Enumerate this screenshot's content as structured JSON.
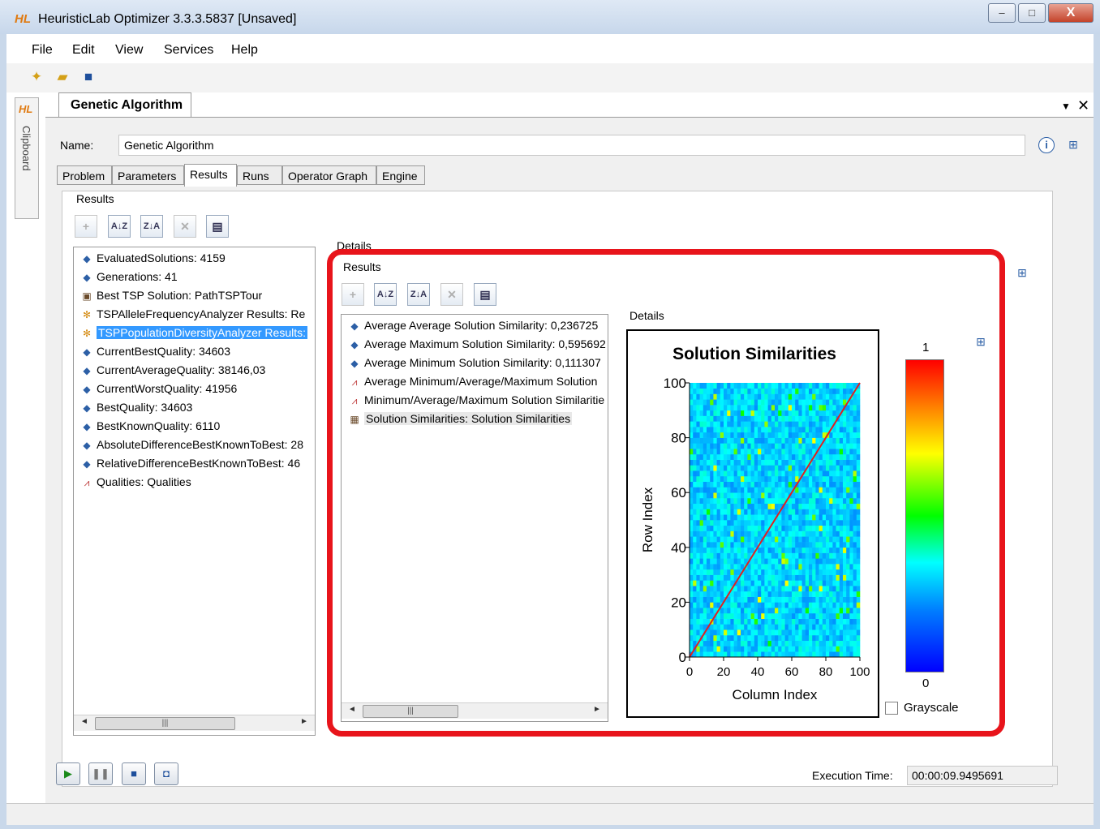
{
  "window": {
    "logo": "HL",
    "title": "HeuristicLab Optimizer 3.3.3.5837 [Unsaved]",
    "controls": {
      "minimize": "–",
      "maximize": "□",
      "close": "X"
    }
  },
  "menu": [
    "File",
    "Edit",
    "View",
    "Services",
    "Help"
  ],
  "sidebar": {
    "logo": "HL",
    "label": "Clipboard"
  },
  "document_tab": {
    "label": "Genetic Algorithm",
    "dropdown_icon": "▼",
    "close_icon": "✕"
  },
  "name_field": {
    "label": "Name:",
    "value": "Genetic Algorithm"
  },
  "tabs": [
    "Problem",
    "Parameters",
    "Results",
    "Runs",
    "Operator Graph",
    "Engine"
  ],
  "active_tab": "Results",
  "results": {
    "group_title": "Results",
    "details_title": "Details",
    "items": [
      {
        "icon": "diamond",
        "text": "EvaluatedSolutions: 4159"
      },
      {
        "icon": "diamond",
        "text": "Generations: 41"
      },
      {
        "icon": "image",
        "text": "Best TSP Solution: PathTSPTour"
      },
      {
        "icon": "gears",
        "text": "TSPAlleleFrequencyAnalyzer Results: Re"
      },
      {
        "icon": "gears",
        "text": "TSPPopulationDiversityAnalyzer Results:"
      },
      {
        "icon": "diamond",
        "text": "CurrentBestQuality: 34603"
      },
      {
        "icon": "diamond",
        "text": "CurrentAverageQuality: 38146,03"
      },
      {
        "icon": "diamond",
        "text": "CurrentWorstQuality: 41956"
      },
      {
        "icon": "diamond",
        "text": "BestQuality: 34603"
      },
      {
        "icon": "diamond",
        "text": "BestKnownQuality: 6110"
      },
      {
        "icon": "diamond",
        "text": "AbsoluteDifferenceBestKnownToBest: 28"
      },
      {
        "icon": "diamond",
        "text": "RelativeDifferenceBestKnownToBest: 46"
      },
      {
        "icon": "chart",
        "text": "Qualities: Qualities"
      }
    ]
  },
  "inner_results": {
    "group_title": "Results",
    "details_title": "Details",
    "items": [
      {
        "icon": "diamond",
        "text": "Average Average Solution Similarity: 0,236725"
      },
      {
        "icon": "diamond",
        "text": "Average Maximum Solution Similarity: 0,595692"
      },
      {
        "icon": "diamond",
        "text": "Average Minimum Solution Similarity: 0,111307"
      },
      {
        "icon": "chart",
        "text": "Average Minimum/Average/Maximum Solution"
      },
      {
        "icon": "chart",
        "text": "Minimum/Average/Maximum Solution Similaritie"
      },
      {
        "icon": "matrix",
        "text": "Solution Similarities: Solution Similarities"
      }
    ]
  },
  "chart_data": {
    "type": "heatmap",
    "title": "Solution Similarities",
    "xlabel": "Column Index",
    "ylabel": "Row Index",
    "xlim": [
      0,
      100
    ],
    "ylim": [
      0,
      100
    ],
    "xticks": [
      "0",
      "20",
      "40",
      "60",
      "80",
      "100"
    ],
    "yticks": [
      "0",
      "20",
      "40",
      "60",
      "80",
      "100"
    ],
    "colorbar": {
      "max": "1",
      "min": "0"
    },
    "note_values": "diagonal = 1 (red), off-diagonal mostly 0.2-0.4 (cyan/blue)"
  },
  "grayscale_label": "Grayscale",
  "execution": {
    "label": "Execution Time:",
    "value": "00:00:09.9495691"
  },
  "toolbar_buttons": {
    "add": "+",
    "sort_asc": "A↓Z",
    "sort_desc": "Z↓A",
    "remove": "✕",
    "show": "▤"
  },
  "colors": {
    "highlight": "#e8141b",
    "selection": "#3399ff"
  }
}
